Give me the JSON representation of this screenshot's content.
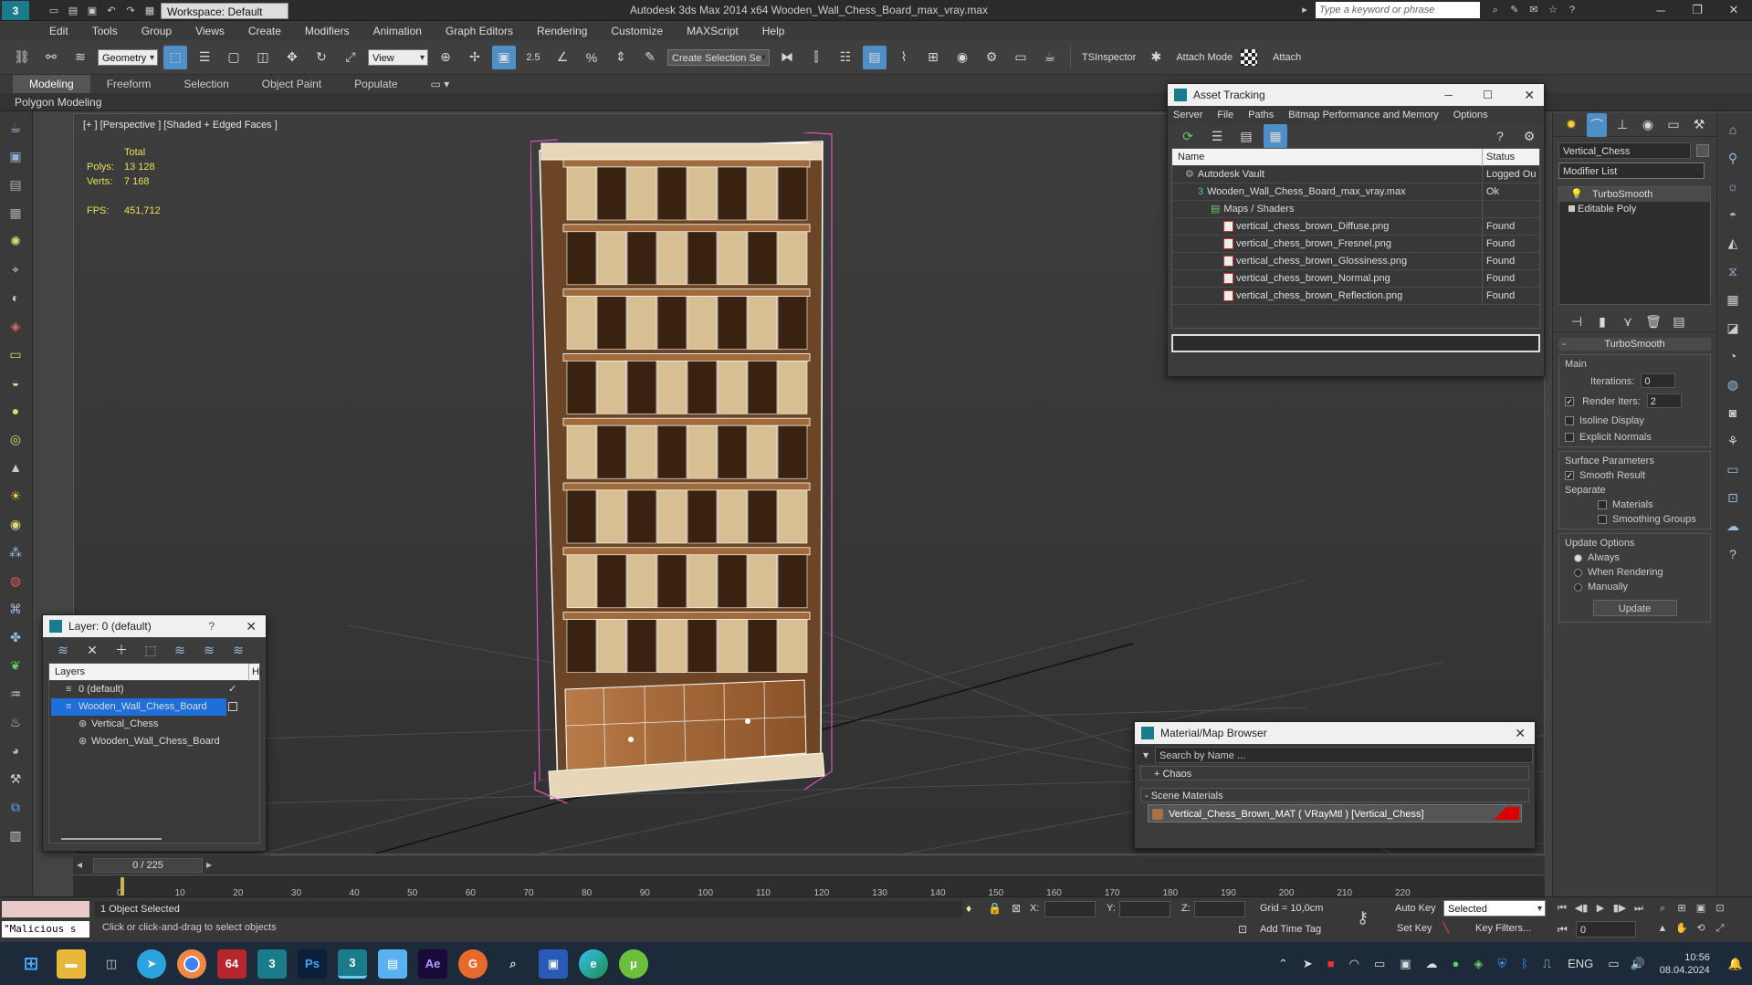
{
  "app": {
    "title": "Autodesk 3ds Max  2014 x64    Wooden_Wall_Chess_Board_max_vray.max",
    "workspace": "Workspace: Default",
    "search_placeholder": "Type a keyword or phrase"
  },
  "menu": [
    "Edit",
    "Tools",
    "Group",
    "Views",
    "Create",
    "Modifiers",
    "Animation",
    "Graph Editors",
    "Rendering",
    "Customize",
    "MAXScript",
    "Help"
  ],
  "toolbar": {
    "selection_filter": "Geometry",
    "ref_coord": "View",
    "spinner_value": "2.5",
    "named_selection": "Create Selection Se",
    "tsinspector": "TSInspector",
    "attach_mode": "Attach Mode",
    "attach": "Attach"
  },
  "ribbon": {
    "tabs": [
      "Modeling",
      "Freeform",
      "Selection",
      "Object Paint",
      "Populate"
    ],
    "sub": "Polygon Modeling"
  },
  "viewport": {
    "label": "[+ ] [Perspective ] [Shaded + Edged Faces ]",
    "total_label": "Total",
    "polys_label": "Polys:",
    "polys_value": "13 128",
    "verts_label": "Verts:",
    "verts_value": "7 168",
    "fps_label": "FPS:",
    "fps_value": "451,712"
  },
  "asset_tracking": {
    "title": "Asset Tracking",
    "menu": [
      "Server",
      "File",
      "Paths",
      "Bitmap Performance and Memory",
      "Options"
    ],
    "col_name": "Name",
    "col_status": "Status",
    "rows": [
      {
        "name": "Autodesk Vault",
        "status": "Logged Ou",
        "indent": 1,
        "icon": "vault"
      },
      {
        "name": "Wooden_Wall_Chess_Board_max_vray.max",
        "status": "Ok",
        "indent": 2,
        "icon": "max"
      },
      {
        "name": "Maps / Shaders",
        "status": "",
        "indent": 3,
        "icon": "folder"
      },
      {
        "name": "vertical_chess_brown_Diffuse.png",
        "status": "Found",
        "indent": 4,
        "icon": "png"
      },
      {
        "name": "vertical_chess_brown_Fresnel.png",
        "status": "Found",
        "indent": 4,
        "icon": "png"
      },
      {
        "name": "vertical_chess_brown_Glossiness.png",
        "status": "Found",
        "indent": 4,
        "icon": "png"
      },
      {
        "name": "vertical_chess_brown_Normal.png",
        "status": "Found",
        "indent": 4,
        "icon": "png"
      },
      {
        "name": "vertical_chess_brown_Reflection.png",
        "status": "Found",
        "indent": 4,
        "icon": "png"
      }
    ]
  },
  "layer_panel": {
    "title": "Layer: 0 (default)",
    "help": "?",
    "col_layers": "Layers",
    "col_hide": "Hi",
    "rows": [
      {
        "name": "0 (default)",
        "indent": 1,
        "selected": false
      },
      {
        "name": "Wooden_Wall_Chess_Board",
        "indent": 1,
        "selected": true
      },
      {
        "name": "Vertical_Chess",
        "indent": 2,
        "selected": false
      },
      {
        "name": "Wooden_Wall_Chess_Board",
        "indent": 2,
        "selected": false
      }
    ]
  },
  "material_browser": {
    "title": "Material/Map Browser",
    "search_placeholder": "Search by Name ...",
    "group1": "+ Chaos",
    "group2": "- Scene Materials",
    "material": "Vertical_Chess_Brown_MAT ( VRayMtl ) [Vertical_Chess]"
  },
  "command_panel": {
    "object_name": "Vertical_Chess",
    "modifier_list": "Modifier List",
    "stack": [
      "TurboSmooth",
      "Editable Poly"
    ],
    "turbosmooth": {
      "header": "TurboSmooth",
      "main": "Main",
      "iterations_label": "Iterations:",
      "iterations_value": "0",
      "render_iters_label": "Render Iters:",
      "render_iters_value": "2",
      "isoline": "Isoline Display",
      "explicit_normals": "Explicit Normals",
      "surface_params": "Surface Parameters",
      "smooth_result": "Smooth Result",
      "separate": "Separate",
      "materials": "Materials",
      "smoothing_groups": "Smoothing Groups",
      "update_options": "Update Options",
      "always": "Always",
      "when_rendering": "When Rendering",
      "manually": "Manually",
      "update_btn": "Update"
    }
  },
  "timeline": {
    "frame_counter": "0 / 225",
    "ticks": [
      "0",
      "10",
      "20",
      "30",
      "40",
      "50",
      "60",
      "70",
      "80",
      "90",
      "100",
      "110",
      "120",
      "130",
      "140",
      "150",
      "160",
      "170",
      "180",
      "190",
      "200",
      "210",
      "220"
    ]
  },
  "status": {
    "script_field": "\"Malicious s",
    "selected_text": "1 Object Selected",
    "prompt": "Click or click-and-drag to select objects",
    "x_label": "X:",
    "y_label": "Y:",
    "z_label": "Z:",
    "grid": "Grid = 10,0cm",
    "add_time_tag": "Add Time Tag",
    "auto_key": "Auto Key",
    "auto_key_mode": "Selected",
    "set_key": "Set Key",
    "key_filters": "Key Filters...",
    "frame": "0"
  },
  "taskbar": {
    "lang": "ENG",
    "time": "10:56",
    "date": "08.04.2024",
    "badge64": "64"
  },
  "colors": {
    "accent": "#4f8fc7",
    "brand": "#1a7c8a",
    "selection_blue": "#1e6fd9",
    "wire": "#ff5ad8"
  }
}
